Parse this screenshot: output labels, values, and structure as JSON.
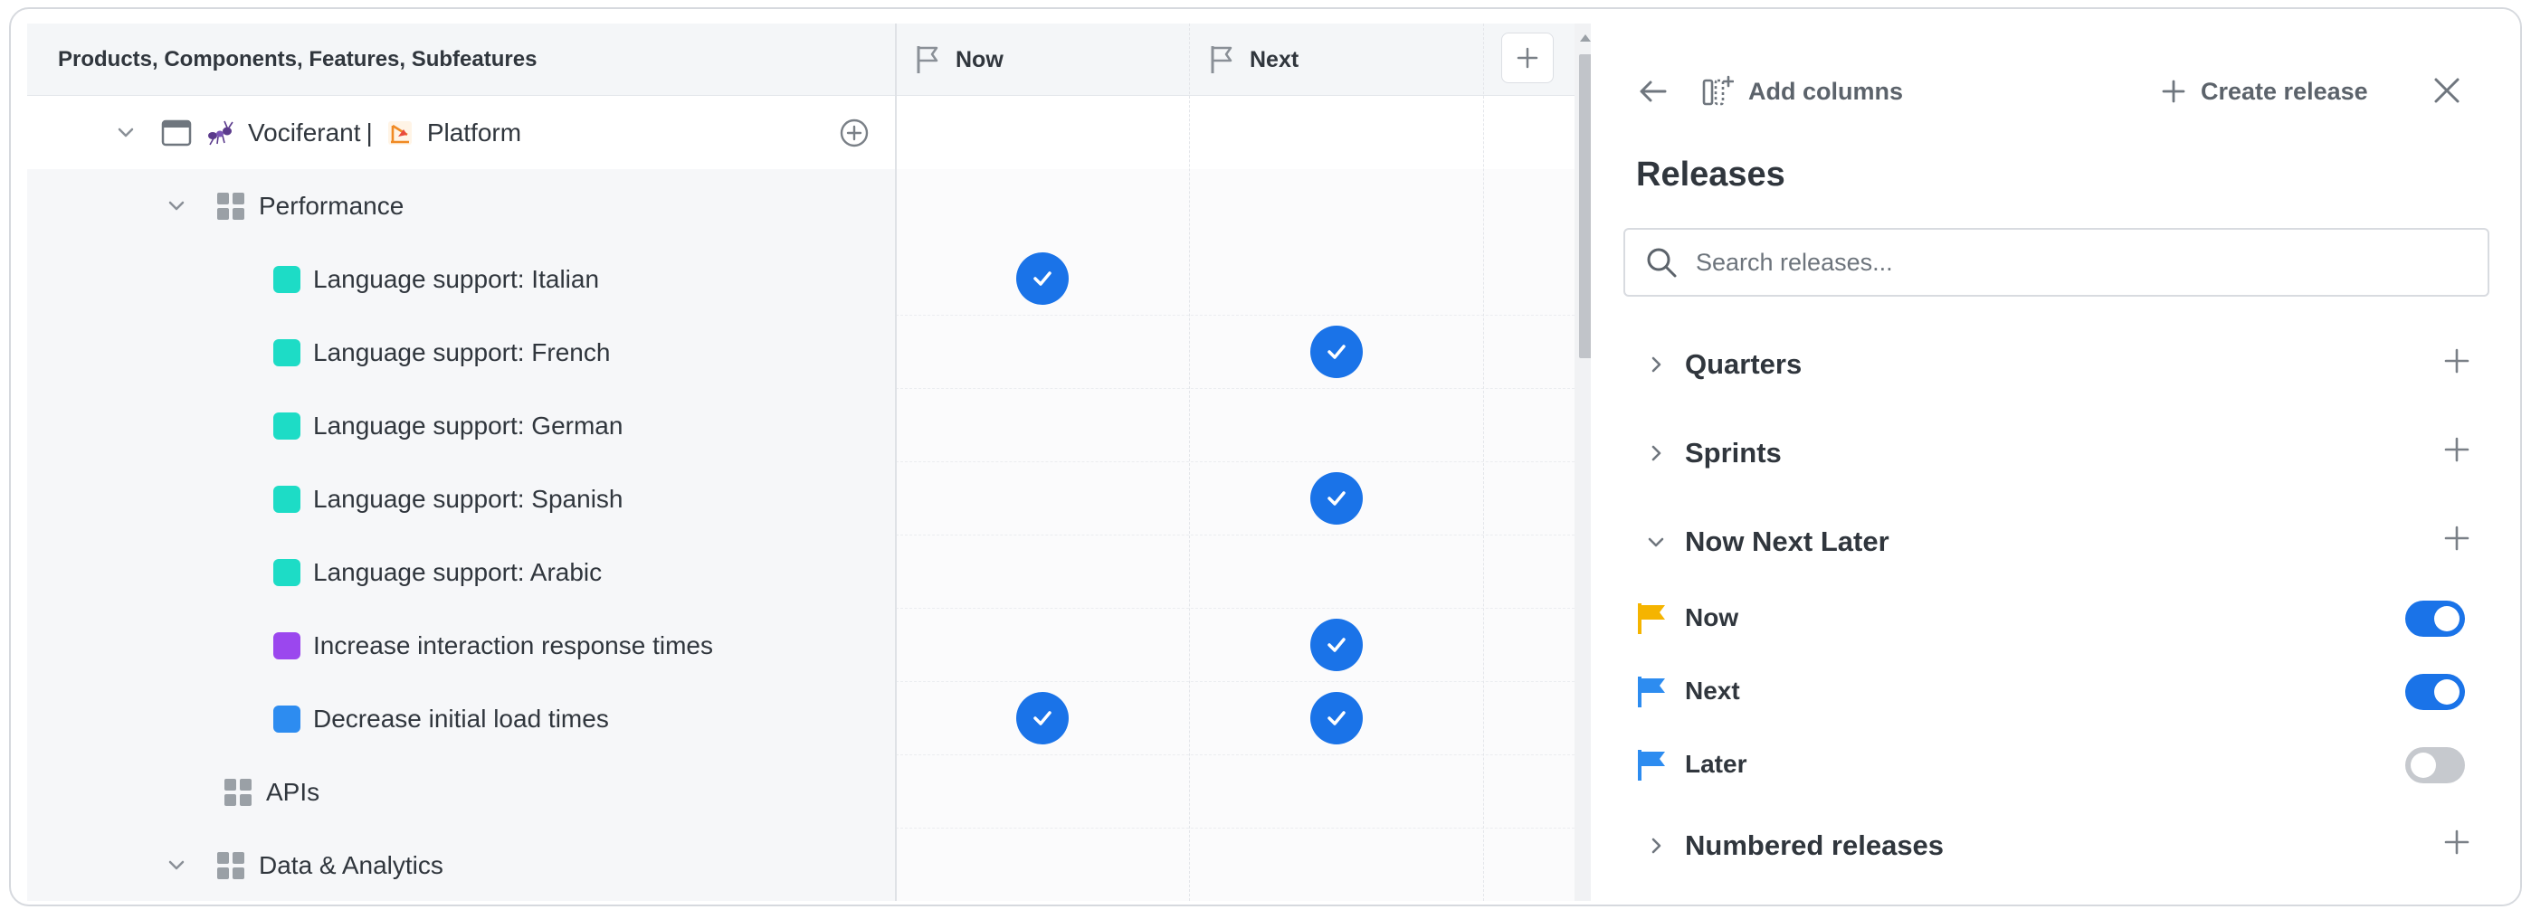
{
  "grid": {
    "header": {
      "title": "Products, Components, Features, Subfeatures",
      "columns": [
        {
          "label": "Now"
        },
        {
          "label": "Next"
        }
      ],
      "add_column_icon": "plus-icon"
    },
    "rows": [
      {
        "type": "product",
        "label_main": "Vociferant",
        "separator": "|",
        "label_sub": "Platform",
        "icons": [
          "chevron-down-icon",
          "window-icon",
          "ant-logo-icon",
          "platform-logo-icon",
          "add-circle-icon"
        ]
      },
      {
        "type": "component",
        "label": "Performance"
      },
      {
        "type": "feature",
        "label": "Language support: Italian",
        "color": "#1ddcc6",
        "now": true,
        "next": false
      },
      {
        "type": "feature",
        "label": "Language support: French",
        "color": "#1ddcc6",
        "now": false,
        "next": true
      },
      {
        "type": "feature",
        "label": "Language support: German",
        "color": "#1ddcc6",
        "now": false,
        "next": false
      },
      {
        "type": "feature",
        "label": "Language support: Spanish",
        "color": "#1ddcc6",
        "now": false,
        "next": true
      },
      {
        "type": "feature",
        "label": "Language support: Arabic",
        "color": "#1ddcc6",
        "now": false,
        "next": false
      },
      {
        "type": "feature",
        "label": "Increase interaction response times",
        "color": "#9b47ee",
        "now": false,
        "next": true
      },
      {
        "type": "feature",
        "label": "Decrease initial load times",
        "color": "#2d8cf0",
        "now": true,
        "next": true
      },
      {
        "type": "component",
        "label": "APIs"
      },
      {
        "type": "component",
        "label": "Data & Analytics"
      }
    ]
  },
  "panel": {
    "back_icon": "arrow-left-icon",
    "add_columns_label": "Add columns",
    "create_release_label": "Create release",
    "close_icon": "close-icon",
    "title": "Releases",
    "search_placeholder": "Search releases...",
    "sections": [
      {
        "label": "Quarters",
        "expanded": false
      },
      {
        "label": "Sprints",
        "expanded": false
      },
      {
        "label": "Now Next Later",
        "expanded": true
      },
      {
        "label": "Numbered releases",
        "expanded": false
      }
    ],
    "releases": [
      {
        "label": "Now",
        "flag_color": "#f5b400",
        "enabled": true
      },
      {
        "label": "Next",
        "flag_color": "#2d8cf0",
        "enabled": true
      },
      {
        "label": "Later",
        "flag_color": "#2d8cf0",
        "enabled": false
      }
    ]
  },
  "colors": {
    "accent": "#1a73e8",
    "teal": "#1ddcc6",
    "purple": "#9b47ee",
    "blue": "#2d8cf0",
    "yellow": "#f5b400"
  }
}
